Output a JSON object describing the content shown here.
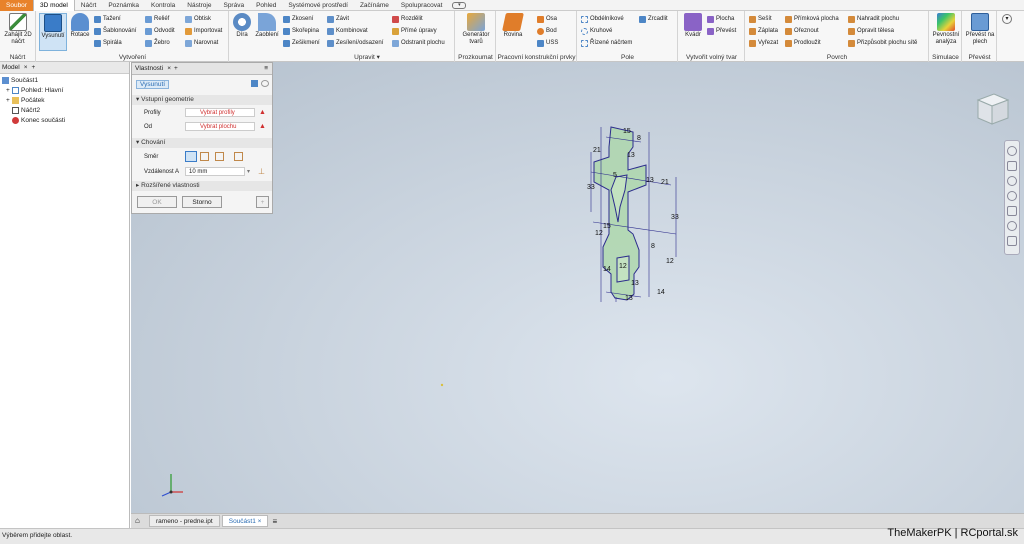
{
  "menu": {
    "file": "Soubor",
    "tabs": [
      "3D model",
      "Náčrt",
      "Poznámka",
      "Kontrola",
      "Nástroje",
      "Správa",
      "Pohled",
      "Systémové prostředí",
      "Začínáme",
      "Spolupracovat"
    ],
    "active_tab": "3D model"
  },
  "ribbon": {
    "sketch_panel": {
      "title": "Náčrt",
      "start_sketch": "Zahájit 2D náčrt"
    },
    "create_panel": {
      "title": "Vytvoření",
      "extrude": "Vysunutí",
      "revolve": "Rotace",
      "small": [
        "Tažení",
        "Šablonování",
        "Spirála",
        "Reliéf",
        "Odvodit",
        "Žebro",
        "Obtisk",
        "Importovat",
        "Narovnat"
      ]
    },
    "hole_fillet": {
      "hole": "Díra",
      "fillet": "Zaoblení"
    },
    "modify_panel": {
      "title": "Upravit",
      "title_arrow": "▾",
      "small": [
        "Zkosení",
        "Skořepina",
        "Zešikmení",
        "Závit",
        "Kombinovat",
        "Zesílení/odsazení",
        "Rozdělit",
        "Přímé úpravy",
        "Odstranit plochu"
      ]
    },
    "explore_panel": {
      "title": "Prozkoumat",
      "generator": "Generátor tvarů"
    },
    "work_features": {
      "title": "Pracovní konstrukční prvky",
      "plane": "Rovina",
      "small": [
        "Osa",
        "Bod",
        "USS"
      ]
    },
    "pattern_panel": {
      "title": "Pole",
      "small": [
        "Obdélníkové",
        "Kruhové",
        "Řízené náčrtem",
        "Zrcadlit"
      ]
    },
    "freeform_panel": {
      "title": "Vytvořit volný tvar",
      "box": "Kvádr",
      "small": [
        "Plocha",
        "Převést"
      ]
    },
    "surface_panel": {
      "title": "Povrch",
      "small": [
        "Sešít",
        "Záplata",
        "Vyřezat",
        "Přímková plocha",
        "Ořeznout",
        "Prodloužit",
        "Nahradit plochu",
        "Opravit tělesa",
        "Přizpůsobit plochu sítě"
      ]
    },
    "simulation_panel": {
      "title": "Simulace",
      "stress": "Pevnostní analýza"
    },
    "convert_panel": {
      "title": "Převést",
      "convert": "Převést na plech"
    }
  },
  "browser": {
    "tabs": [
      "Model",
      "+"
    ],
    "items": [
      "Součást1",
      "Pohled: Hlavní",
      "Počátek",
      "Náčrt2",
      "Konec součásti"
    ]
  },
  "properties": {
    "title": "Vlastnosti",
    "feature_tab": "Vysunutí",
    "input_geometry": "Vstupní geometrie",
    "profiles_label": "Profily",
    "profiles_value": "Vybrat profily",
    "from_label": "Od",
    "from_value": "Vybrat plochu",
    "behavior": "Chování",
    "direction_label": "Směr",
    "distance_label": "Vzdálenost A",
    "distance_value": "10 mm",
    "advanced": "Rozšířené vlastnosti",
    "ok": "OK",
    "cancel": "Storno"
  },
  "sketch_dims": [
    "15",
    "8",
    "13",
    "21",
    "5",
    "13",
    "21",
    "33",
    "33",
    "15",
    "12",
    "8",
    "12",
    "14",
    "12",
    "14",
    "13",
    "13"
  ],
  "doc_tabs": [
    "rameno - predne.ipt",
    "Součást1"
  ],
  "status": "Výběrem přidejte oblast.",
  "watermark": "TheMakerPK | RCportal.sk",
  "colors": {
    "accent": "#e8822a",
    "sketch": "#2c2c8c",
    "fill": "#a9d7a6"
  }
}
